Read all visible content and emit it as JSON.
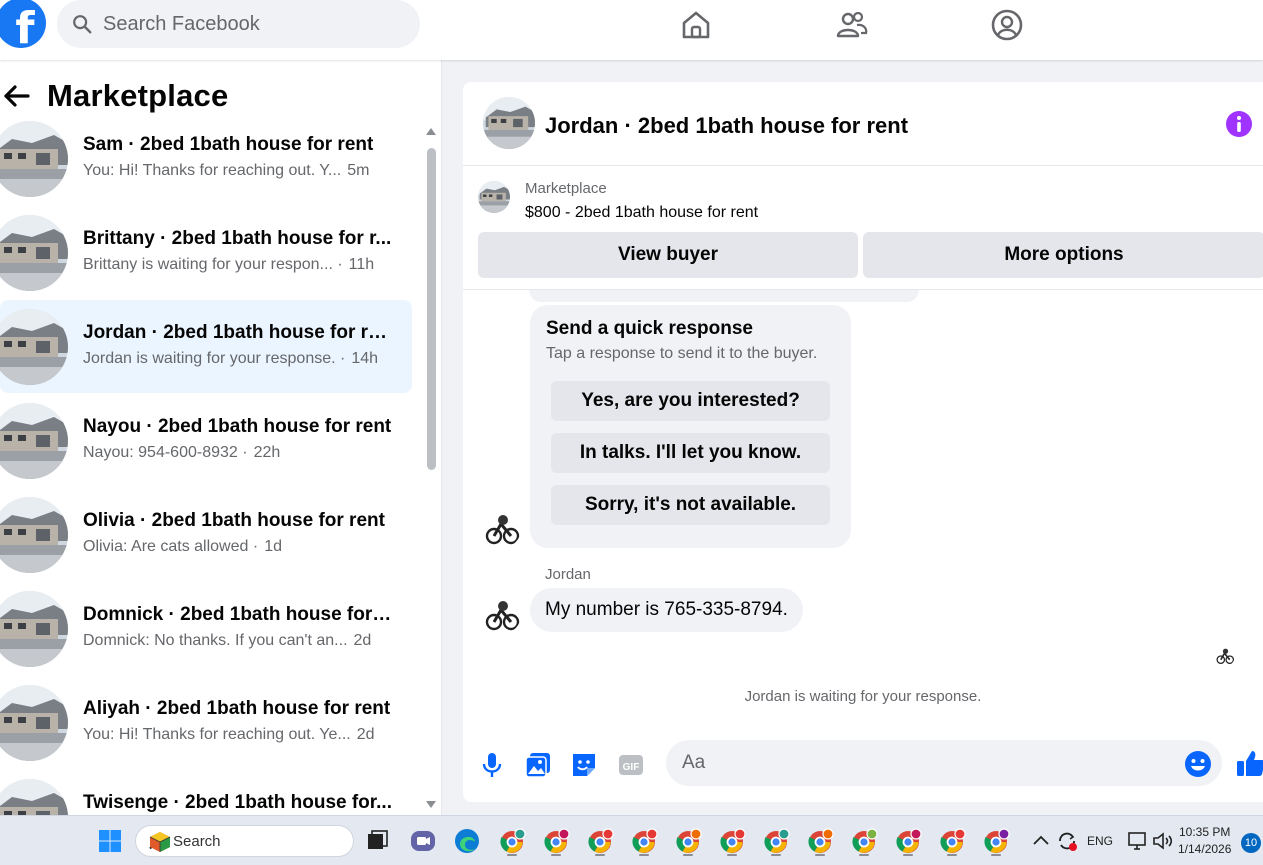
{
  "topbar": {
    "logo_letter": "f",
    "search_placeholder": "Search Facebook",
    "nav_icons": [
      "home-icon",
      "friends-icon",
      "profile-icon"
    ]
  },
  "marketplace": {
    "title": "Marketplace",
    "conversations": [
      {
        "name": "Sam · 2bed 1bath house for rent",
        "preview": "You: Hi! Thanks for reaching out. Y...",
        "time": "5m",
        "active": false
      },
      {
        "name": "Brittany · 2bed 1bath house for r...",
        "preview": "Brittany is waiting for your respon... ·",
        "time": "11h",
        "active": false
      },
      {
        "name": "Jordan · 2bed 1bath house for re...",
        "preview": "Jordan is waiting for your response. ·",
        "time": "14h",
        "active": true
      },
      {
        "name": "Nayou · 2bed 1bath house for rent",
        "preview": "Nayou: 954-600-8932 ·",
        "time": "22h",
        "active": false
      },
      {
        "name": "Olivia · 2bed 1bath house for rent",
        "preview": "Olivia: Are cats allowed ·",
        "time": "1d",
        "active": false
      },
      {
        "name": "Domnick · 2bed 1bath house for ...",
        "preview": "Domnick: No thanks. If you can't an...",
        "time": "2d",
        "active": false
      },
      {
        "name": "Aliyah · 2bed 1bath house for rent",
        "preview": "You: Hi! Thanks for reaching out. Ye...",
        "time": "2d",
        "active": false
      },
      {
        "name": "Twisenge · 2bed 1bath house for...",
        "preview": "",
        "time": "",
        "active": false
      }
    ]
  },
  "chat": {
    "title": "Jordan · 2bed 1bath house for rent",
    "listing_label": "Marketplace",
    "listing_title": "$800 - 2bed 1bath house for rent",
    "view_buyer": "View buyer",
    "more_options": "More options",
    "quick_response": {
      "title": "Send a quick response",
      "subtitle": "Tap a response to send it to the buyer.",
      "options": [
        "Yes, are you interested?",
        "In talks. I'll let you know.",
        "Sorry, it's not available."
      ]
    },
    "sender": "Jordan",
    "message": "My number is 765-335-8794.",
    "waiting_note": "Jordan is waiting for your response.",
    "composer_placeholder": "Aa",
    "accent_color": "#0866ff",
    "info_color": "#a033ff"
  },
  "taskbar": {
    "search_label": "Search",
    "language": "ENG",
    "time": "10:35 PM",
    "date": "1/14/2026",
    "notification_count": "10"
  }
}
